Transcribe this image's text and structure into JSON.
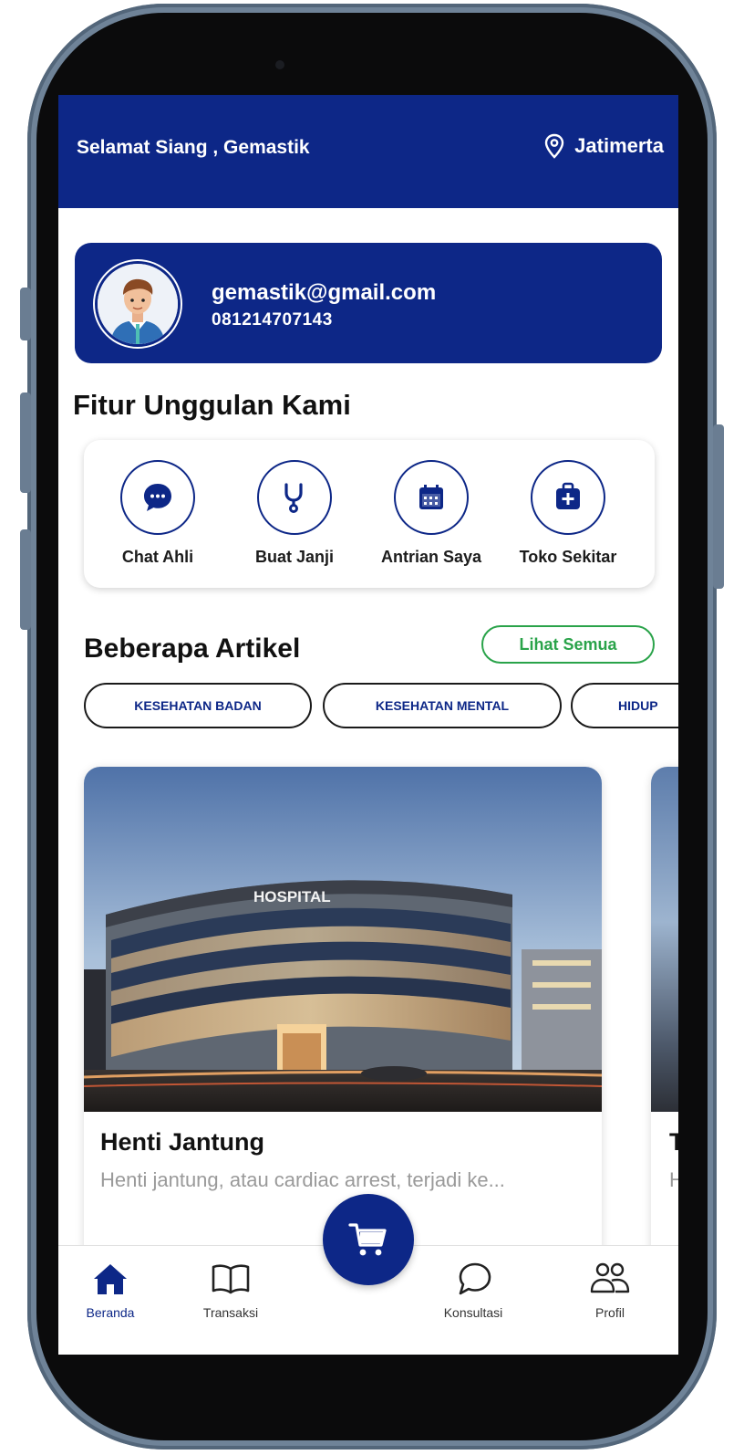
{
  "header": {
    "greeting": "Selamat Siang , Gemastik",
    "location": "Jatimerta",
    "location_icon": "map-pin-icon"
  },
  "profile": {
    "email": "gemastik@gmail.com",
    "phone": "081214707143",
    "avatar_icon": "user-avatar"
  },
  "features": {
    "title": "Fitur Unggulan Kami",
    "items": [
      {
        "label": "Chat Ahli",
        "icon": "chat-bubble-icon"
      },
      {
        "label": "Buat Janji",
        "icon": "stethoscope-icon"
      },
      {
        "label": "Antrian Saya",
        "icon": "calendar-icon"
      },
      {
        "label": "Toko Sekitar",
        "icon": "medical-bag-icon"
      }
    ]
  },
  "articles": {
    "title": "Beberapa Artikel",
    "see_all": "Lihat Semua",
    "categories": [
      "KESEHATAN BADAN",
      "KESEHATAN MENTAL",
      "HIDUP"
    ],
    "items": [
      {
        "image_sign": "HOSPITAL",
        "title": "Henti Jantung",
        "description": "Henti jantung, atau cardiac arrest, terjadi ke..."
      },
      {
        "title": "T",
        "description": "H"
      }
    ]
  },
  "bottom_nav": {
    "items": [
      {
        "label": "Beranda",
        "icon": "home-icon",
        "active": true
      },
      {
        "label": "Transaksi",
        "icon": "book-icon",
        "active": false
      },
      {
        "label": "Konsultasi",
        "icon": "chat-outline-icon",
        "active": false
      },
      {
        "label": "Profil",
        "icon": "users-icon",
        "active": false
      }
    ],
    "cart_icon": "shopping-cart-icon"
  },
  "colors": {
    "primary": "#0d2787",
    "accent_green": "#2aa34a",
    "muted_text": "#9a9a9a"
  }
}
